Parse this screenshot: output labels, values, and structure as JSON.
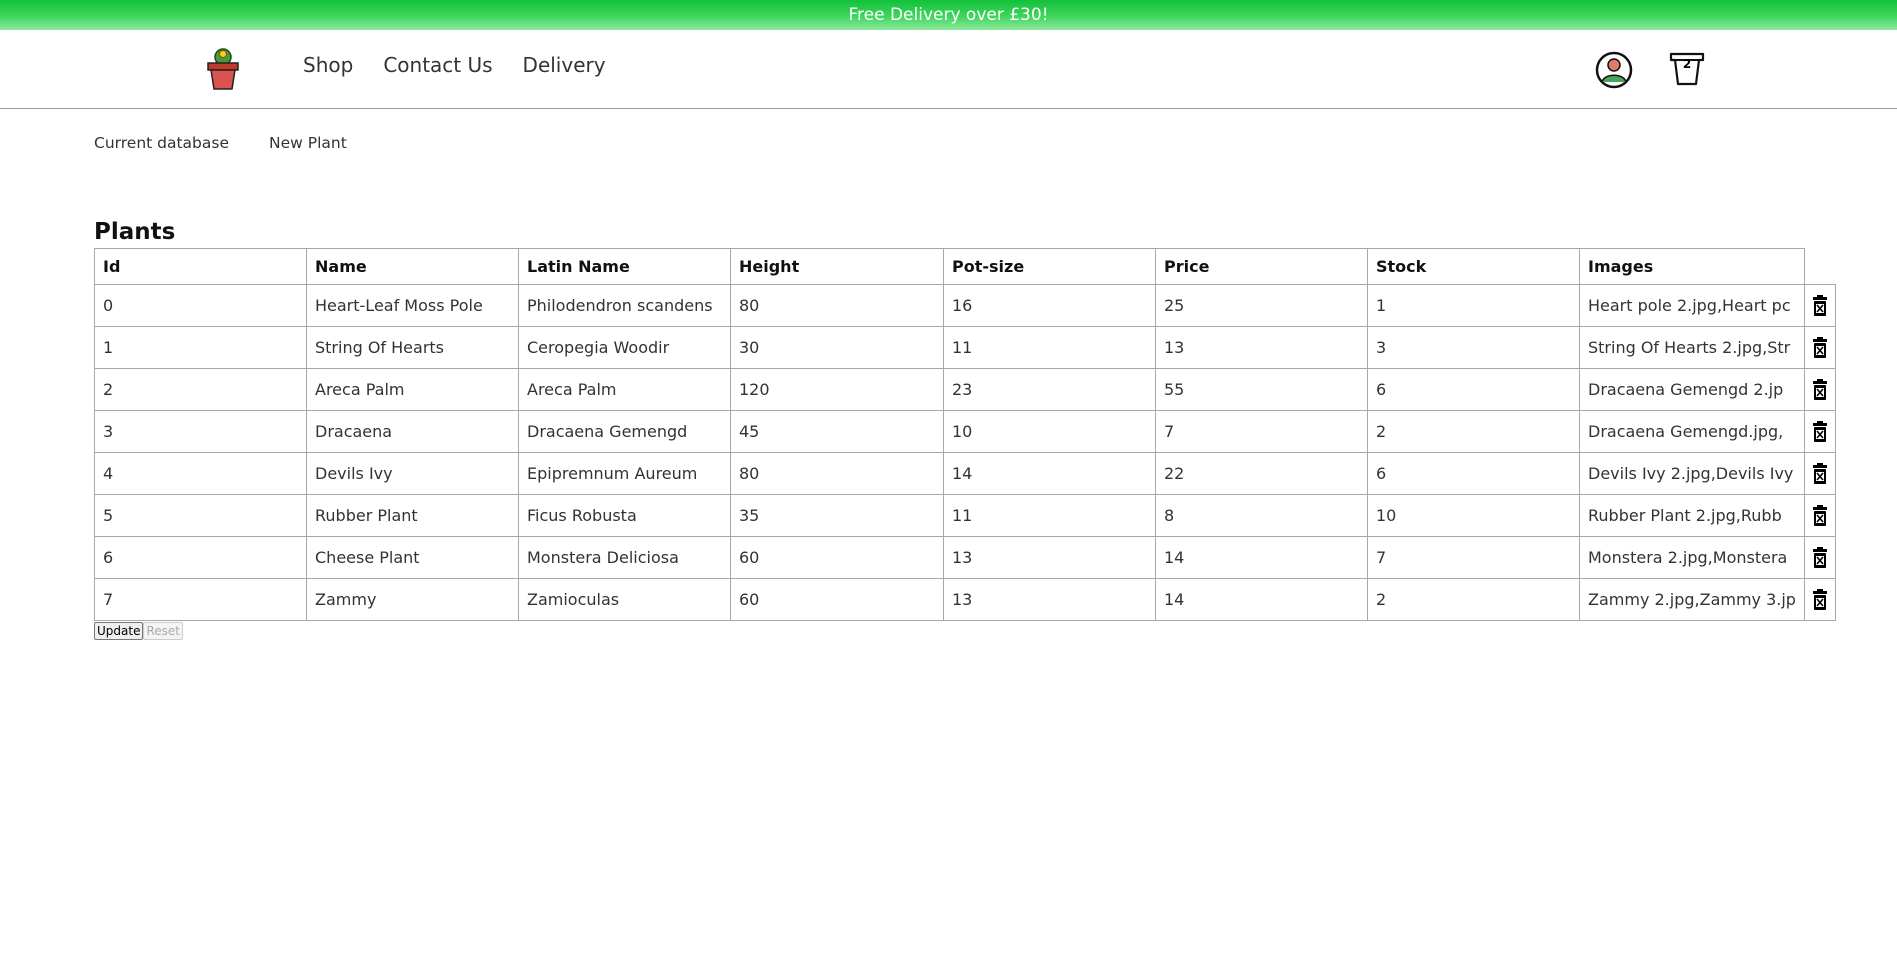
{
  "promo": {
    "text": "Free Delivery over £30!"
  },
  "nav": {
    "items": [
      {
        "label": "Shop"
      },
      {
        "label": "Contact Us"
      },
      {
        "label": "Delivery"
      }
    ]
  },
  "cart": {
    "count": "2"
  },
  "subnav": {
    "items": [
      {
        "label": "Current database"
      },
      {
        "label": "New Plant"
      }
    ]
  },
  "page": {
    "title": "Plants"
  },
  "table": {
    "headers": [
      "Id",
      "Name",
      "Latin Name",
      "Height",
      "Pot-size",
      "Price",
      "Stock",
      "Images"
    ],
    "rows": [
      [
        "0",
        "Heart-Leaf Moss Pole",
        "Philodendron scandens",
        "80",
        "16",
        "25",
        "1",
        "Heart pole 2.jpg,Heart pc"
      ],
      [
        "1",
        "String Of Hearts",
        "Ceropegia Woodir",
        "30",
        "11",
        "13",
        "3",
        "String Of Hearts 2.jpg,Str"
      ],
      [
        "2",
        "Areca Palm",
        "Areca Palm",
        "120",
        "23",
        "55",
        "6",
        "Dracaena Gemengd 2.jp"
      ],
      [
        "3",
        "Dracaena",
        "Dracaena Gemengd",
        "45",
        "10",
        "7",
        "2",
        "Dracaena Gemengd.jpg,"
      ],
      [
        "4",
        "Devils Ivy",
        "Epipremnum Aureum",
        "80",
        "14",
        "22",
        "6",
        "Devils Ivy 2.jpg,Devils Ivy"
      ],
      [
        "5",
        "Rubber Plant",
        "Ficus Robusta",
        "35",
        "11",
        "8",
        "10",
        "Rubber Plant 2.jpg,Rubb"
      ],
      [
        "6",
        "Cheese Plant",
        "Monstera Deliciosa",
        "60",
        "13",
        "14",
        "7",
        "Monstera 2.jpg,Monstera"
      ],
      [
        "7",
        "Zammy",
        "Zamioculas",
        "60",
        "13",
        "14",
        "2",
        "Zammy 2.jpg,Zammy 3.jp"
      ]
    ]
  },
  "form": {
    "update_label": "Update",
    "reset_label": "Reset"
  },
  "icons": {
    "logo": "potted-cactus-logo",
    "account": "user-account-icon",
    "cart": "plant-pot-cart-icon",
    "delete": "trash-icon"
  }
}
